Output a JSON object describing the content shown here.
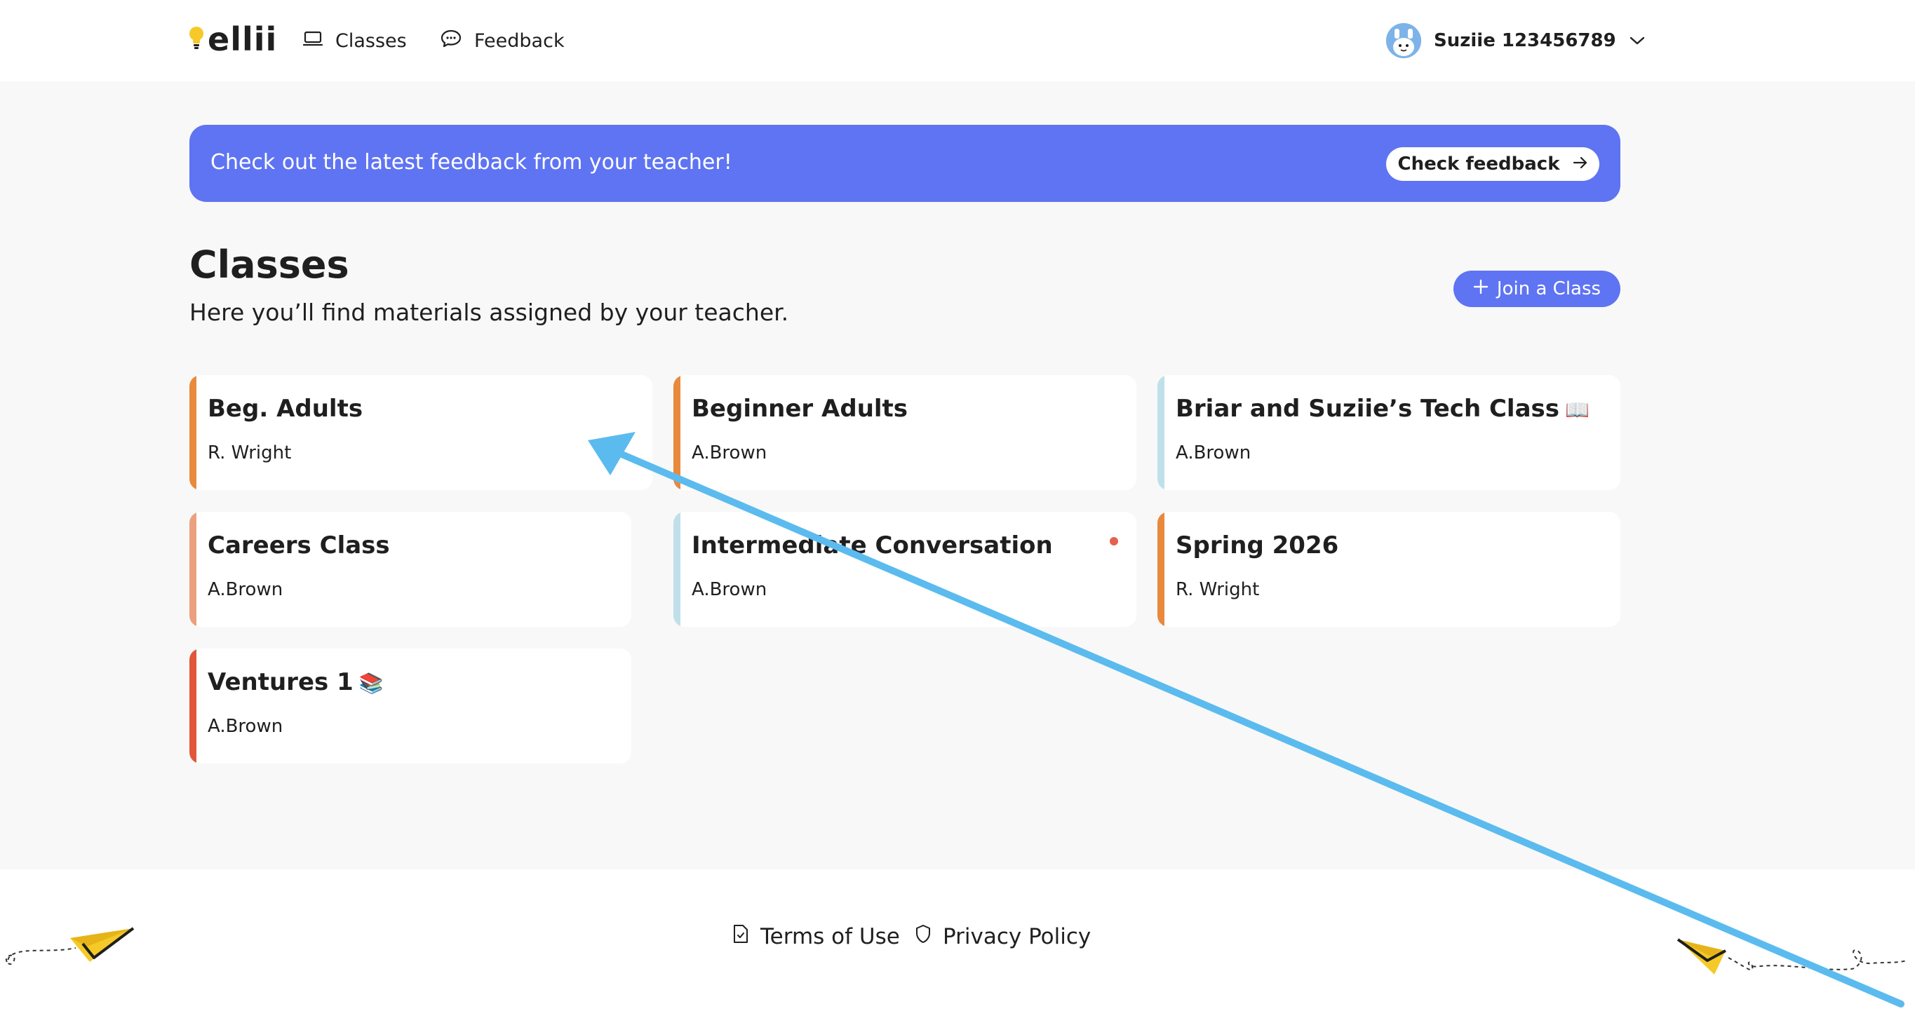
{
  "app": {
    "logo_text": "ellii",
    "brand_color": "#5f74f2"
  },
  "nav": {
    "classes_label": "Classes",
    "classes_icon": "laptop-icon",
    "feedback_label": "Feedback",
    "feedback_icon": "chat-bubble-icon"
  },
  "user": {
    "name": "Suziie 123456789",
    "menu_icon": "chevron-down-icon"
  },
  "banner": {
    "text": "Check out the latest feedback from your teacher!",
    "button_label": "Check feedback",
    "button_icon": "arrow-right-icon"
  },
  "classes": {
    "title": "Classes",
    "subtitle": "Here you’ll find materials assigned by your teacher.",
    "join_label": "Join a Class",
    "join_icon": "plus-icon",
    "cards": [
      {
        "name": "Beg. Adults",
        "teacher": "R. Wright",
        "accent": "#e8893c",
        "emoji": "",
        "unread": false
      },
      {
        "name": "Beginner Adults",
        "teacher": "A.Brown",
        "accent": "#e8893c",
        "emoji": "",
        "unread": false
      },
      {
        "name": "Briar and Suziie’s Tech Class",
        "teacher": "A.Brown",
        "accent": "#bfe0ea",
        "emoji": "📖",
        "unread": false
      },
      {
        "name": "Careers Class",
        "teacher": "A.Brown",
        "accent": "#eba07e",
        "emoji": "",
        "unread": false
      },
      {
        "name": "Intermediate Conversation",
        "teacher": "A.Brown",
        "accent": "#bfe0ea",
        "emoji": "",
        "unread": true
      },
      {
        "name": "Spring 2026",
        "teacher": "R. Wright",
        "accent": "#e8893c",
        "emoji": "",
        "unread": false
      },
      {
        "name": "Ventures 1",
        "teacher": "A.Brown",
        "accent": "#e0573c",
        "emoji": "📚",
        "unread": false
      }
    ]
  },
  "footer": {
    "terms_label": "Terms of Use",
    "terms_icon": "document-check-icon",
    "privacy_label": "Privacy Policy",
    "privacy_icon": "shield-icon",
    "decoration_icon": "paper-plane-icon"
  }
}
